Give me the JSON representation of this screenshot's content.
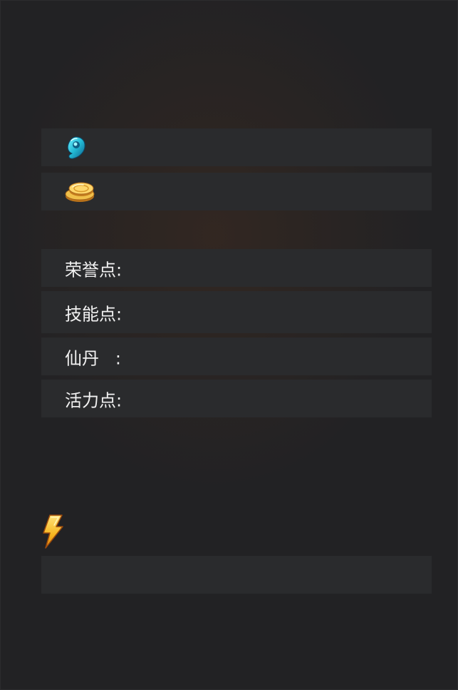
{
  "currency_rows": [
    {
      "icon": "blue-spirit-gem-icon",
      "value": ""
    },
    {
      "icon": "gold-coins-icon",
      "value": ""
    }
  ],
  "stats": [
    {
      "label": "荣誉点:",
      "value": ""
    },
    {
      "label": "技能点:",
      "value": ""
    },
    {
      "label": "仙丹   :",
      "value": ""
    },
    {
      "label": "活力点:",
      "value": ""
    }
  ],
  "energy": {
    "icon": "lightning-energy-icon",
    "value": ""
  },
  "colors": {
    "background": "#222224",
    "row": "#2a2b2d",
    "text": "#f2f2f2",
    "gem": "#27c6d9",
    "gold": "#f0c04a",
    "lightning": "#f5b51f"
  }
}
